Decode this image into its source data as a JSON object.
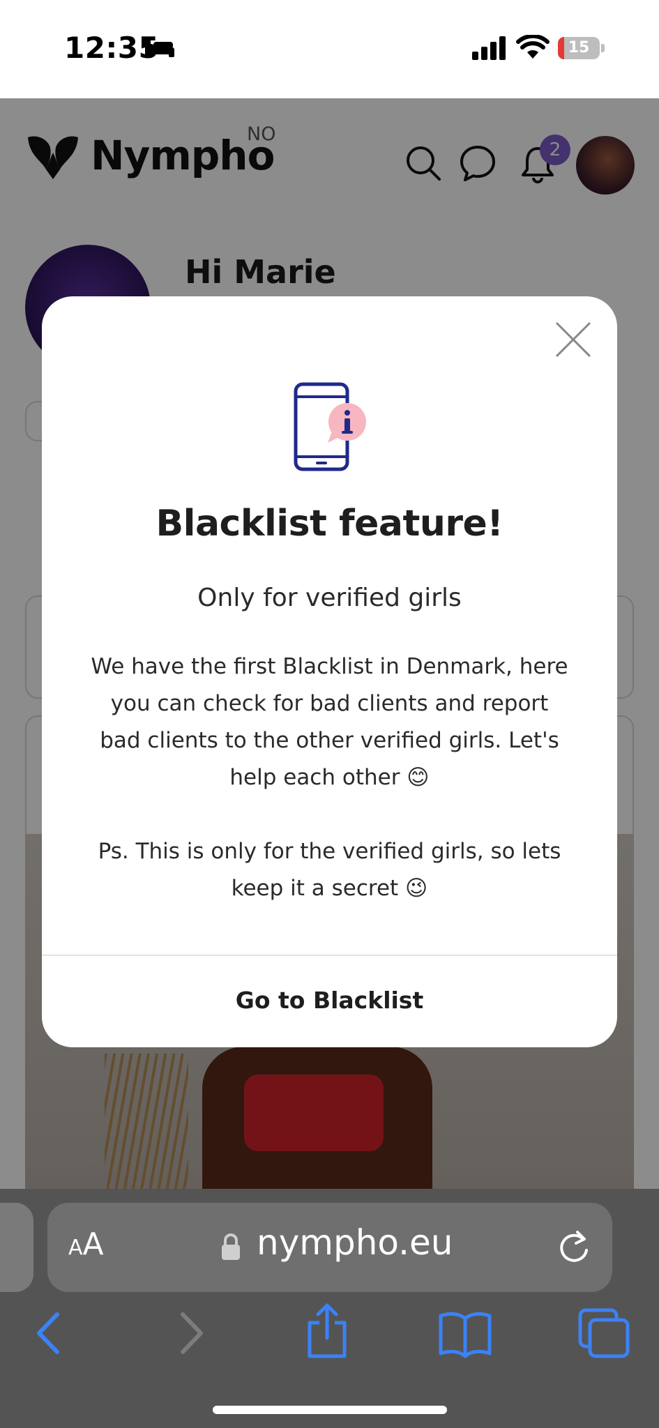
{
  "status_bar": {
    "time": "12:35",
    "focus_icon": "bed-icon",
    "battery_level": "15",
    "battery_fraction": 0.15,
    "battery_color": "#e53935"
  },
  "site": {
    "logo_text": "Nympho",
    "language": "NO",
    "notification_count": "2",
    "greeting": "Hi Marie",
    "badge_color": "#7b5cc9"
  },
  "modal": {
    "icon": "phone-info-icon",
    "title": "Blacklist feature!",
    "subtitle": "Only for verified girls",
    "body": "We have the first Blacklist in Denmark, here you can check for bad clients and report bad clients to the other verified girls. Let's help each other 😊",
    "ps": "Ps. This is only for the verified girls, so lets keep it a secret 😉",
    "cta": "Go to Blacklist",
    "icon_colors": {
      "outline": "#1f2a8a",
      "bubble": "#f7b6c0"
    }
  },
  "browser": {
    "text_size_label_small": "A",
    "text_size_label_large": "A",
    "url": "nympho.eu",
    "accent": "#3b82f6"
  }
}
